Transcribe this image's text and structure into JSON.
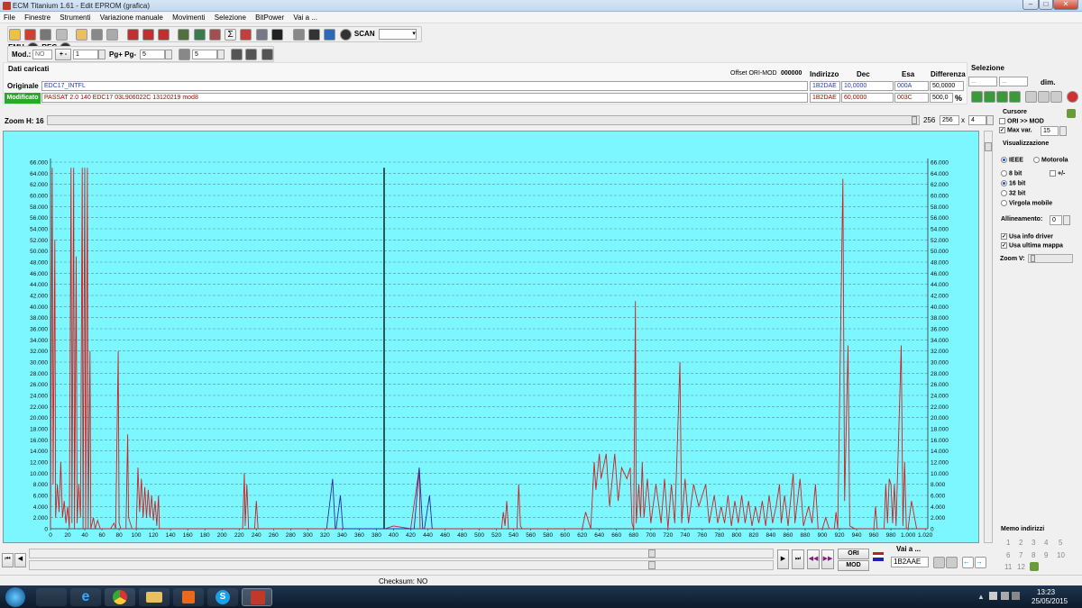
{
  "window": {
    "title": "ECM Titanium 1.61 - Edit EPROM (grafica)"
  },
  "menu": [
    "File",
    "Finestre",
    "Strumenti",
    "Variazione manuale",
    "Movimenti",
    "Selezione",
    "BitPower",
    "Vai a ..."
  ],
  "toolbar": {
    "scan": "SCAN",
    "emu": "EMU",
    "rec": "REC"
  },
  "toolbar2": {
    "mod_label": "Mod.:",
    "mod_value": "NO",
    "plusminus_label": "+ -",
    "plusminus_value": "1",
    "pg_label": "Pg+ Pg-",
    "pg_value": "5",
    "val3": "5"
  },
  "data": {
    "header": "Dati caricati",
    "offset_label": "Offset ORI-MOD",
    "offset_value": "000000",
    "col_indirizzo": "Indirizzo",
    "col_dec": "Dec",
    "col_esa": "Esa",
    "col_diff": "Differenza",
    "orig_label": "Originale",
    "orig_name": "EDC17_INTFL",
    "orig_addr": "1B2DAE",
    "orig_dec": "10,0000",
    "orig_esa": "000A",
    "orig_diff": "50,0000",
    "mod_label": "Modificato",
    "mod_name": "PASSAT 2.0 140 EDC17 03L906022C 13120219 mod8",
    "mod_addr": "1B2DAE",
    "mod_dec": "60,0000",
    "mod_esa": "003C",
    "mod_diff": "500,0"
  },
  "selezione": {
    "title": "Selezione",
    "v1": "...",
    "v2": "...",
    "dim": "dim."
  },
  "zoom": {
    "label": "Zoom H: 16",
    "w": "256",
    "h": "256",
    "x": "x",
    "m": "4"
  },
  "right": {
    "cursore": "Cursore",
    "ori_mod": "ORI >> MOD",
    "max_var": "Max var.",
    "max_var_value": "15",
    "visualizzazione": "Visualizzazione",
    "ieee": "IEEE",
    "motorola": "Motorola",
    "bit8": "8 bit",
    "pm": "+/-",
    "bit16": "16 bit",
    "bit32": "32 bit",
    "virgola": "Virgola mobile",
    "allineamento": "Allineamento:",
    "allineamento_value": "0",
    "usa_info": "Usa info driver",
    "usa_ultima": "Usa ultima mappa",
    "zoom_v": "Zoom V:",
    "memo": "Memo indirizzi",
    "memo_nums": [
      "1",
      "2",
      "3",
      "4",
      "5",
      "6",
      "7",
      "8",
      "9",
      "10",
      "11",
      "12"
    ]
  },
  "bottom": {
    "ori": "ORI",
    "mod": "MOD",
    "vai": "Vai a ...",
    "vai_value": "1B2AAE",
    "checksum": "Checksum: NO"
  },
  "taskbar": {
    "time": "13:23",
    "date": "25/05/2015"
  },
  "chart_data": {
    "type": "line",
    "xlim": [
      0,
      1023
    ],
    "ylim": [
      0,
      66000
    ],
    "x_ticks": [
      0,
      20,
      40,
      60,
      80,
      100,
      120,
      140,
      160,
      180,
      200,
      220,
      240,
      260,
      280,
      300,
      320,
      340,
      360,
      380,
      400,
      420,
      440,
      460,
      480,
      500,
      520,
      540,
      560,
      580,
      600,
      620,
      640,
      660,
      680,
      700,
      720,
      740,
      760,
      780,
      800,
      820,
      840,
      860,
      880,
      900,
      920,
      940,
      960,
      980,
      1000,
      1020
    ],
    "x_tick_labels": [
      "0",
      "20",
      "40",
      "60",
      "80",
      "100",
      "120",
      "140",
      "160",
      "180",
      "200",
      "220",
      "240",
      "260",
      "280",
      "300",
      "320",
      "340",
      "360",
      "380",
      "400",
      "420",
      "440",
      "460",
      "480",
      "500",
      "520",
      "540",
      "560",
      "580",
      "600",
      "620",
      "640",
      "660",
      "680",
      "700",
      "720",
      "740",
      "760",
      "780",
      "800",
      "820",
      "840",
      "860",
      "880",
      "900",
      "920",
      "940",
      "960",
      "980",
      "1.000",
      "1.020"
    ],
    "y_ticks": [
      0,
      2000,
      4000,
      6000,
      8000,
      10000,
      12000,
      14000,
      16000,
      18000,
      20000,
      22000,
      24000,
      26000,
      28000,
      30000,
      32000,
      34000,
      36000,
      38000,
      40000,
      42000,
      44000,
      46000,
      48000,
      50000,
      52000,
      54000,
      56000,
      58000,
      60000,
      62000,
      64000,
      66000
    ],
    "y_tick_labels": [
      "0",
      "2.000",
      "4.000",
      "6.000",
      "8.000",
      "10.000",
      "12.000",
      "14.000",
      "16.000",
      "18.000",
      "20.000",
      "22.000",
      "24.000",
      "26.000",
      "28.000",
      "30.000",
      "32.000",
      "34.000",
      "36.000",
      "38.000",
      "40.000",
      "42.000",
      "44.000",
      "46.000",
      "48.000",
      "50.000",
      "52.000",
      "54.000",
      "56.000",
      "58.000",
      "60.000",
      "62.000",
      "64.000",
      "66.000"
    ],
    "grid": true,
    "cursor_x": 389,
    "series": [
      {
        "color": "#cc2222",
        "points": [
          [
            0,
            0
          ],
          [
            2,
            65000
          ],
          [
            3,
            8000
          ],
          [
            5,
            52000
          ],
          [
            6,
            2000
          ],
          [
            8,
            8000
          ],
          [
            10,
            3000
          ],
          [
            12,
            12000
          ],
          [
            14,
            2000
          ],
          [
            16,
            5000
          ],
          [
            18,
            1000
          ],
          [
            20,
            4000
          ],
          [
            22,
            0
          ],
          [
            24,
            65000
          ],
          [
            25,
            1000
          ],
          [
            27,
            65000
          ],
          [
            28,
            0
          ],
          [
            30,
            49000
          ],
          [
            31,
            1000
          ],
          [
            33,
            8000
          ],
          [
            35,
            2000
          ],
          [
            37,
            65000
          ],
          [
            38,
            0
          ],
          [
            40,
            65000
          ],
          [
            41,
            0
          ],
          [
            43,
            65000
          ],
          [
            44,
            0
          ],
          [
            46,
            32000
          ],
          [
            47,
            0
          ],
          [
            50,
            2000
          ],
          [
            52,
            0
          ],
          [
            55,
            1500
          ],
          [
            58,
            0
          ],
          [
            62,
            0
          ],
          [
            70,
            0
          ],
          [
            74,
            1000
          ],
          [
            76,
            0
          ],
          [
            79,
            32000
          ],
          [
            80,
            1000
          ],
          [
            82,
            0
          ],
          [
            88,
            0
          ],
          [
            90,
            17000
          ],
          [
            91,
            2000
          ],
          [
            95,
            0
          ],
          [
            100,
            0
          ],
          [
            102,
            11000
          ],
          [
            104,
            3000
          ],
          [
            106,
            9000
          ],
          [
            108,
            2000
          ],
          [
            110,
            7500
          ],
          [
            112,
            2000
          ],
          [
            114,
            7000
          ],
          [
            116,
            2000
          ],
          [
            118,
            6000
          ],
          [
            120,
            1500
          ],
          [
            122,
            5000
          ],
          [
            124,
            500
          ],
          [
            126,
            6000
          ],
          [
            127,
            0
          ],
          [
            130,
            0
          ],
          [
            150,
            0
          ],
          [
            224,
            0
          ],
          [
            226,
            10000
          ],
          [
            227,
            500
          ],
          [
            229,
            8000
          ],
          [
            231,
            0
          ],
          [
            238,
            0
          ],
          [
            240,
            5000
          ],
          [
            242,
            0
          ],
          [
            250,
            0
          ],
          [
            330,
            0
          ],
          [
            390,
            0
          ],
          [
            400,
            500
          ],
          [
            420,
            0
          ],
          [
            430,
            11000
          ],
          [
            431,
            0
          ],
          [
            470,
            0
          ],
          [
            526,
            0
          ],
          [
            528,
            3000
          ],
          [
            530,
            500
          ],
          [
            532,
            5000
          ],
          [
            534,
            0
          ],
          [
            544,
            0
          ],
          [
            546,
            8000
          ],
          [
            548,
            500
          ],
          [
            550,
            0
          ],
          [
            620,
            0
          ],
          [
            624,
            3000
          ],
          [
            630,
            0
          ],
          [
            634,
            12000
          ],
          [
            636,
            7000
          ],
          [
            640,
            13500
          ],
          [
            642,
            9000
          ],
          [
            648,
            13500
          ],
          [
            652,
            4000
          ],
          [
            658,
            13500
          ],
          [
            662,
            5000
          ],
          [
            666,
            11000
          ],
          [
            672,
            9000
          ],
          [
            676,
            11000
          ],
          [
            678,
            1000
          ],
          [
            680,
            0
          ],
          [
            682,
            41000
          ],
          [
            683,
            1000
          ],
          [
            686,
            8000
          ],
          [
            688,
            2000
          ],
          [
            690,
            12000
          ],
          [
            692,
            2000
          ],
          [
            696,
            9000
          ],
          [
            700,
            1000
          ],
          [
            706,
            8000
          ],
          [
            712,
            1000
          ],
          [
            716,
            9000
          ],
          [
            720,
            0
          ],
          [
            724,
            8000
          ],
          [
            728,
            1000
          ],
          [
            734,
            30000
          ],
          [
            736,
            1000
          ],
          [
            740,
            9000
          ],
          [
            744,
            1000
          ],
          [
            750,
            8000
          ],
          [
            756,
            4000
          ],
          [
            760,
            6000
          ],
          [
            764,
            8000
          ],
          [
            768,
            1000
          ],
          [
            774,
            6000
          ],
          [
            778,
            1000
          ],
          [
            782,
            4000
          ],
          [
            786,
            1000
          ],
          [
            790,
            6000
          ],
          [
            794,
            500
          ],
          [
            798,
            5000
          ],
          [
            802,
            1000
          ],
          [
            806,
            6000
          ],
          [
            810,
            1000
          ],
          [
            814,
            5000
          ],
          [
            818,
            500
          ],
          [
            822,
            4000
          ],
          [
            826,
            1000
          ],
          [
            830,
            5000
          ],
          [
            834,
            500
          ],
          [
            838,
            6000
          ],
          [
            842,
            1000
          ],
          [
            846,
            4000
          ],
          [
            850,
            8000
          ],
          [
            852,
            1000
          ],
          [
            856,
            6000
          ],
          [
            860,
            500
          ],
          [
            866,
            10000
          ],
          [
            868,
            1000
          ],
          [
            874,
            9000
          ],
          [
            878,
            500
          ],
          [
            884,
            4000
          ],
          [
            888,
            1000
          ],
          [
            892,
            8000
          ],
          [
            895,
            0
          ],
          [
            900,
            0
          ],
          [
            904,
            2000
          ],
          [
            908,
            0
          ],
          [
            914,
            0
          ],
          [
            916,
            3000
          ],
          [
            918,
            0
          ],
          [
            924,
            63000
          ],
          [
            926,
            5000
          ],
          [
            930,
            33000
          ],
          [
            932,
            500
          ],
          [
            938,
            0
          ],
          [
            960,
            0
          ],
          [
            962,
            4000
          ],
          [
            964,
            0
          ],
          [
            972,
            0
          ],
          [
            974,
            8000
          ],
          [
            976,
            1000
          ],
          [
            978,
            9000
          ],
          [
            980,
            8000
          ],
          [
            982,
            1000
          ],
          [
            984,
            8000
          ],
          [
            986,
            500
          ],
          [
            992,
            33000
          ],
          [
            994,
            500
          ],
          [
            996,
            12000
          ],
          [
            998,
            0
          ],
          [
            1000,
            0
          ],
          [
            1004,
            5000
          ],
          [
            1010,
            0
          ],
          [
            1023,
            0
          ]
        ]
      },
      {
        "color": "#2a2aa8",
        "points": [
          [
            322,
            0
          ],
          [
            329,
            9000
          ],
          [
            332,
            0
          ],
          [
            333,
            0
          ],
          [
            338,
            6000
          ],
          [
            341,
            0
          ],
          [
            424,
            0
          ],
          [
            430,
            11000
          ],
          [
            434,
            0
          ],
          [
            436,
            0
          ],
          [
            442,
            6000
          ],
          [
            445,
            0
          ]
        ]
      },
      {
        "color": "#111111",
        "points": [
          [
            389,
            0
          ],
          [
            389,
            65000
          ],
          [
            389,
            0
          ]
        ]
      }
    ]
  }
}
